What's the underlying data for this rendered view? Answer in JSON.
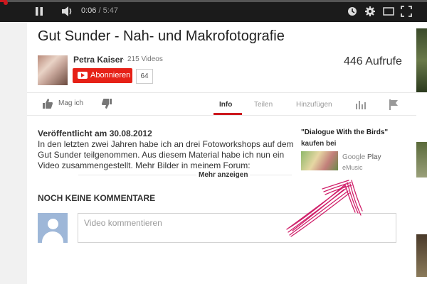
{
  "player": {
    "current_time": "0:06",
    "duration": "5:47",
    "progress_fraction": 0.017,
    "icons": [
      "pause-icon",
      "volume-icon",
      "watch-later-icon",
      "settings-icon",
      "theater-mode-icon",
      "fullscreen-icon"
    ]
  },
  "video": {
    "title": "Gut Sunder - Nah- und Makrofotografie",
    "views": "446 Aufrufe"
  },
  "channel": {
    "name": "Petra Kaiser",
    "separator": "·",
    "videos": "215 Videos",
    "subscribe_label": "Abonnieren",
    "subscriber_count": "64"
  },
  "actions": {
    "like_label": "Mag ich"
  },
  "tabs": [
    {
      "label": "Info",
      "active": true
    },
    {
      "label": "Teilen",
      "active": false
    },
    {
      "label": "Hinzufügen",
      "active": false
    }
  ],
  "description": {
    "published": "Veröffentlicht am 30.08.2012",
    "lines": [
      "In den letzten zwei Jahren habe ich an drei Fotoworkshops auf dem",
      "Gut Sunder teilgenommen. Aus diesem Material habe ich nun ein",
      "Video zusammengestellt. Mehr Bilder in meinem Forum:"
    ],
    "more_label": "Mehr anzeigen"
  },
  "music": {
    "title": "\"Dialogue With the Birds\"",
    "buy_label": "kaufen bei",
    "store_google_a": "Google",
    "store_google_b": "Play",
    "store_emusic": "eMusic"
  },
  "comments": {
    "heading": "NOCH KEINE KOMMENTARE",
    "placeholder": "Video kommentieren"
  },
  "colors": {
    "accent_red": "#cc181e",
    "subscribe_red": "#e62117",
    "annotation_pink": "#d0206a"
  }
}
